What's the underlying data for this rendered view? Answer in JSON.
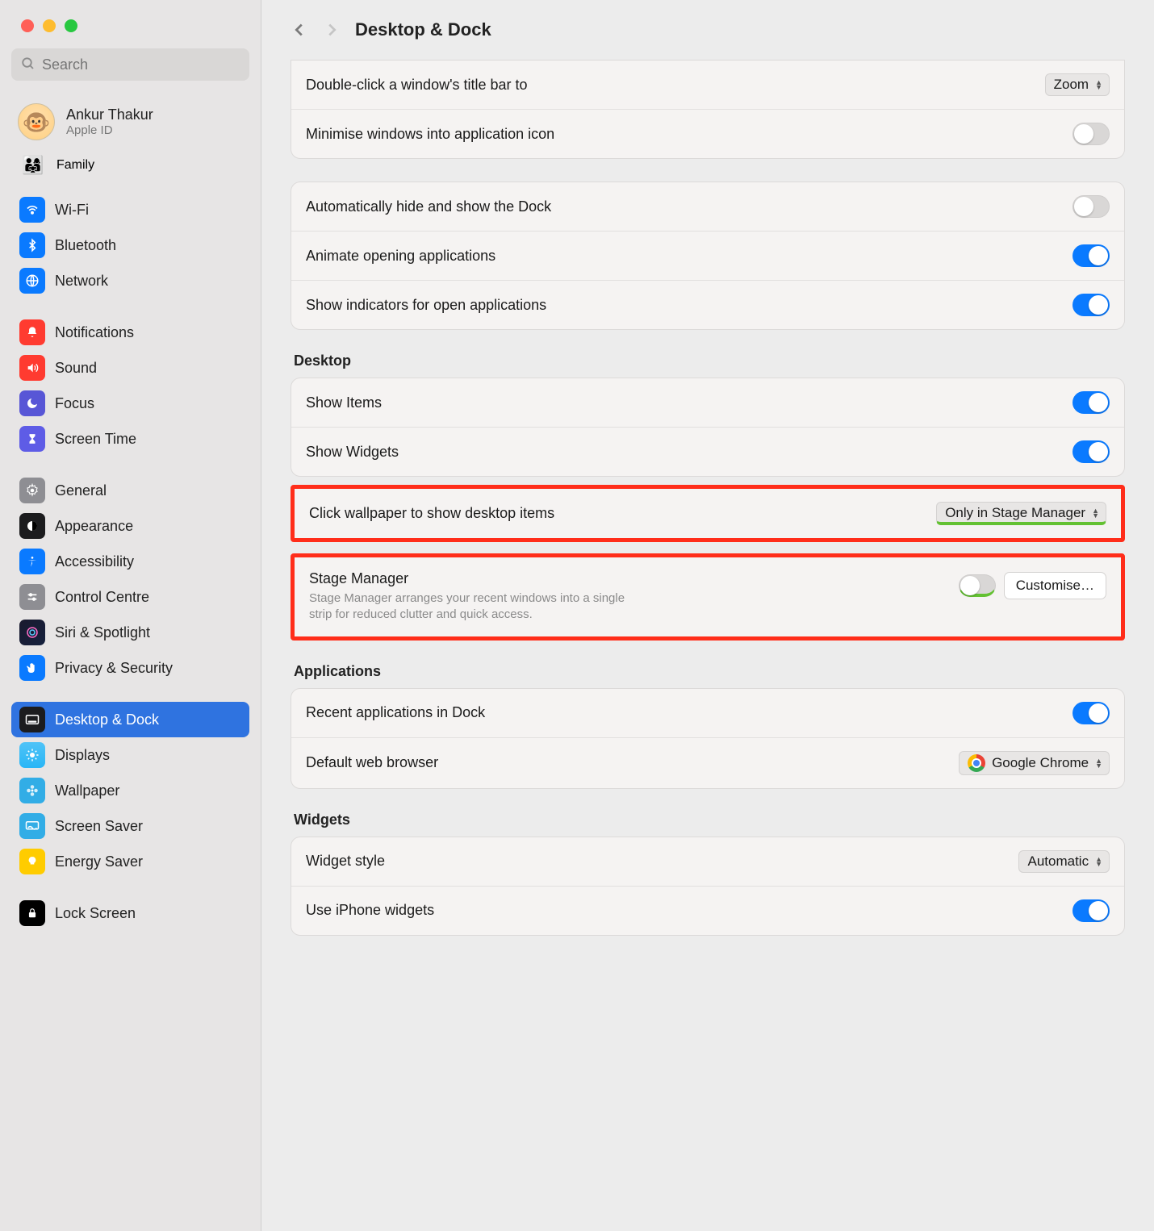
{
  "search": {
    "placeholder": "Search"
  },
  "user": {
    "name": "Ankur Thakur",
    "sub": "Apple ID"
  },
  "family": {
    "label": "Family"
  },
  "sidebar": {
    "g1": [
      {
        "label": "Wi-Fi"
      },
      {
        "label": "Bluetooth"
      },
      {
        "label": "Network"
      }
    ],
    "g2": [
      {
        "label": "Notifications"
      },
      {
        "label": "Sound"
      },
      {
        "label": "Focus"
      },
      {
        "label": "Screen Time"
      }
    ],
    "g3": [
      {
        "label": "General"
      },
      {
        "label": "Appearance"
      },
      {
        "label": "Accessibility"
      },
      {
        "label": "Control Centre"
      },
      {
        "label": "Siri & Spotlight"
      },
      {
        "label": "Privacy & Security"
      }
    ],
    "g4": [
      {
        "label": "Desktop & Dock"
      },
      {
        "label": "Displays"
      },
      {
        "label": "Wallpaper"
      },
      {
        "label": "Screen Saver"
      },
      {
        "label": "Energy Saver"
      }
    ],
    "g5": [
      {
        "label": "Lock Screen"
      }
    ]
  },
  "page": {
    "title": "Desktop & Dock"
  },
  "dock": {
    "double_click_label": "Double-click a window's title bar to",
    "double_click_value": "Zoom",
    "minimise_label": "Minimise windows into application icon",
    "auto_hide_label": "Automatically hide and show the Dock",
    "animate_label": "Animate opening applications",
    "indicators_label": "Show indicators for open applications"
  },
  "desktop": {
    "heading": "Desktop",
    "show_items_label": "Show Items",
    "show_widgets_label": "Show Widgets",
    "click_wallpaper_label": "Click wallpaper to show desktop items",
    "click_wallpaper_value": "Only in Stage Manager",
    "stage_manager_label": "Stage Manager",
    "stage_manager_desc": "Stage Manager arranges your recent windows into a single strip for reduced clutter and quick access.",
    "customise_label": "Customise…"
  },
  "apps": {
    "heading": "Applications",
    "recent_label": "Recent applications in Dock",
    "browser_label": "Default web browser",
    "browser_value": "Google Chrome"
  },
  "widgets": {
    "heading": "Widgets",
    "style_label": "Widget style",
    "style_value": "Automatic",
    "iphone_label": "Use iPhone widgets"
  }
}
